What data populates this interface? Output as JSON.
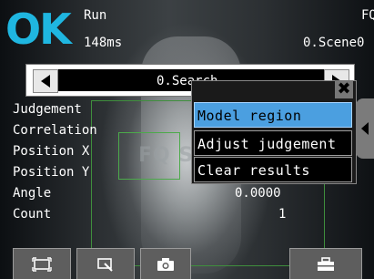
{
  "status": {
    "result": "OK",
    "mode": "Run",
    "time": "148ms",
    "top_right": "FQ",
    "scene": "0.Scene0"
  },
  "search": {
    "label": "0.Search"
  },
  "results": [
    {
      "label": "Judgement",
      "value": ""
    },
    {
      "label": "Correlation",
      "value": ""
    },
    {
      "label": "Position X",
      "value": ""
    },
    {
      "label": "Position Y",
      "value": ""
    },
    {
      "label": "Angle",
      "value": "0.0000"
    },
    {
      "label": "Count",
      "value": "1"
    }
  ],
  "camera_overlay_text": "FQ S",
  "menu": {
    "items": [
      "Model region",
      "Adjust judgement",
      "Clear results"
    ],
    "selected_index": 0
  },
  "toolbar": {
    "icons": [
      "fullscreen-icon",
      "zoom-region-icon",
      "camera-icon",
      "toolbox-icon"
    ]
  },
  "colors": {
    "ok": "#1fb6e0",
    "menu_selected": "#4b9fe0",
    "region_outline": "#4caa4a"
  }
}
